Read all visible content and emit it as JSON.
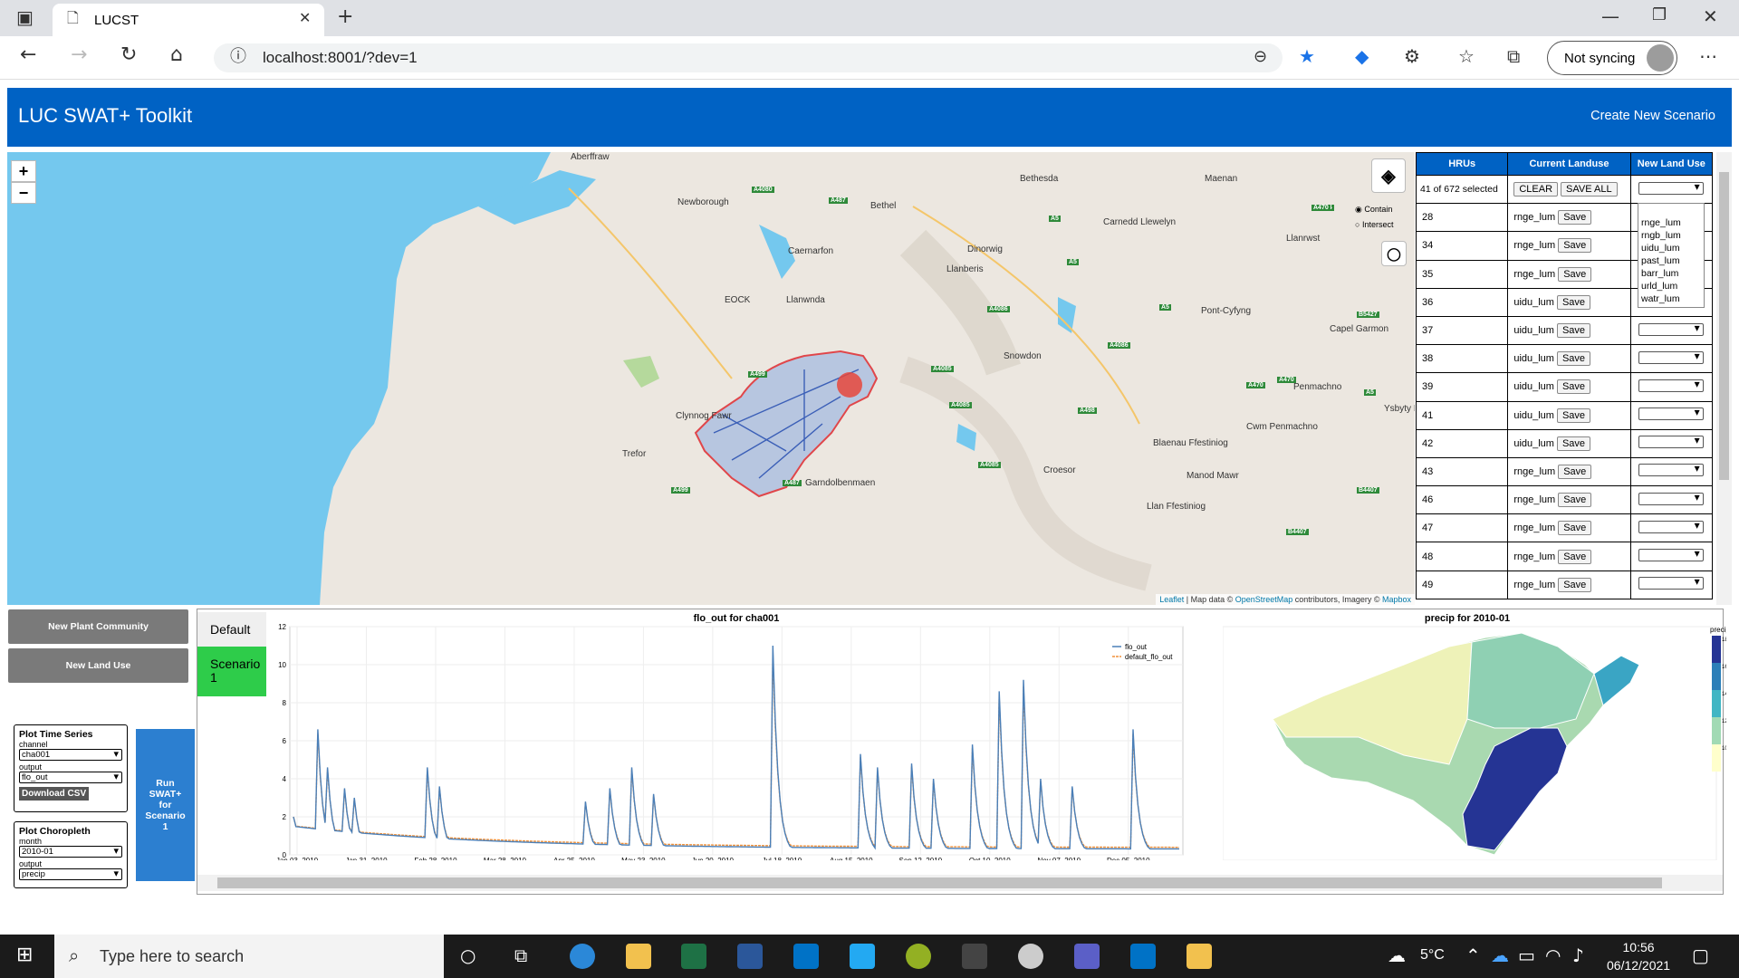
{
  "browser": {
    "tab_title": "LUCST",
    "url": "localhost:8001/?dev=1",
    "sync_label": "Not syncing"
  },
  "app": {
    "title": "LUC SWAT+ Toolkit",
    "create_scenario": "Create New Scenario"
  },
  "map": {
    "zoom_in": "+",
    "zoom_out": "−",
    "places": [
      "Aberffraw",
      "Newborough",
      "Caernarfon",
      "Bethel",
      "Bethesda",
      "Maenan",
      "Carnedd Llewelyn",
      "Llanrwst",
      "Dinorwig",
      "Llanberis",
      "Llanwnda",
      "Pont-Cyfyng",
      "Capel Garmon",
      "Snowdon",
      "Penmachno",
      "Clynnog Fawr",
      "Ysbyty I",
      "Cwm Penmachno",
      "Blaenau Ffestiniog",
      "Trefor",
      "Croesor",
      "Manod Mawr",
      "Garndolbenmaen",
      "Llan Ffestiniog",
      "EOCK"
    ],
    "roads": [
      "A4080",
      "A487",
      "A5",
      "A4244",
      "A5",
      "A470",
      "A4086",
      "A5",
      "B5427",
      "A499",
      "A4085",
      "A4086",
      "A470",
      "A470",
      "A5",
      "A498",
      "A4085",
      "A4085",
      "A487",
      "A499",
      "B4407",
      "B4407"
    ],
    "filter_options": [
      "Contain",
      "Intersect"
    ],
    "attribution": {
      "leaflet": "Leaflet",
      "text1": " | Map data © ",
      "osm": "OpenStreetMap",
      "text2": " contributors, Imagery © ",
      "mapbox": "Mapbox"
    }
  },
  "hru_table": {
    "headers": [
      "HRUs",
      "Current Landuse",
      "New Land Use"
    ],
    "selected_text": "41 of 672 selected",
    "clear_label": "CLEAR",
    "save_all_label": "SAVE ALL",
    "save_label": "Save",
    "rows": [
      [
        "28",
        "rnge_lum"
      ],
      [
        "34",
        "rnge_lum"
      ],
      [
        "35",
        "rnge_lum"
      ],
      [
        "36",
        "uidu_lum"
      ],
      [
        "37",
        "uidu_lum"
      ],
      [
        "38",
        "uidu_lum"
      ],
      [
        "39",
        "uidu_lum"
      ],
      [
        "41",
        "uidu_lum"
      ],
      [
        "42",
        "uidu_lum"
      ],
      [
        "43",
        "rnge_lum"
      ],
      [
        "46",
        "rnge_lum"
      ],
      [
        "47",
        "rnge_lum"
      ],
      [
        "48",
        "rnge_lum"
      ],
      [
        "49",
        "rnge_lum"
      ]
    ],
    "dropdown_options": [
      "rnge_lum",
      "rngb_lum",
      "uidu_lum",
      "past_lum",
      "barr_lum",
      "urld_lum",
      "watr_lum"
    ]
  },
  "sidebar": {
    "new_plant_community": "New Plant Community",
    "new_land_use": "New Land Use",
    "ts_form": {
      "title": "Plot Time Series",
      "channel_label": "channel",
      "channel_value": "cha001",
      "output_label": "output",
      "output_value": "flo_out",
      "download": "Download CSV"
    },
    "choro_form": {
      "title": "Plot Choropleth",
      "month_label": "month",
      "month_value": "2010-01",
      "output_label": "output",
      "output_value": "precip"
    },
    "run_button": "Run SWAT+ for Scenario 1"
  },
  "tabs": [
    "Default",
    "Scenario 1"
  ],
  "chart_data": [
    {
      "type": "line",
      "title": "flo_out for cha001",
      "x_ticks": [
        "Jan 03, 2010",
        "Jan 31, 2010",
        "Feb 28, 2010",
        "Mar 28, 2010",
        "Apr 25, 2010",
        "May 23, 2010",
        "Jun 20, 2010",
        "Jul 18, 2010",
        "Aug 15, 2010",
        "Sep 12, 2010",
        "Oct 10, 2010",
        "Nov 07, 2010",
        "Dec 05, 2010"
      ],
      "ylim": [
        0,
        12
      ],
      "y_ticks": [
        0,
        2,
        4,
        6,
        8,
        10,
        12
      ],
      "grid": true,
      "legend": "top-right",
      "series": [
        {
          "name": "flo_out",
          "color": "#4a7fb8",
          "values": [
            2,
            1.6,
            1.4,
            1.3,
            1.3,
            1.2,
            1.3,
            1.5,
            1.4,
            1.2,
            6.6,
            2,
            1.6,
            1.8,
            4.6,
            2.2,
            1.6,
            1.5,
            1.4,
            1.3,
            1.2,
            3.5,
            2,
            1.5,
            1.4,
            3,
            1.9,
            1.6,
            1.5,
            1.4,
            1.3,
            1.1,
            1.2,
            0.9,
            0.8,
            0.7,
            0.8,
            2,
            1.2,
            0.9,
            0.8,
            0.8,
            0.7,
            1,
            0.8,
            0.6,
            0.6,
            0.7,
            0.6,
            0.5,
            0.5,
            0.5,
            0.9,
            0.6,
            0.4,
            0.4,
            0.3,
            0.3,
            0.3,
            0.3,
            0.3,
            0.5,
            0.4,
            0.3,
            0.3,
            0.3,
            0.3,
            0.3,
            0.3,
            0.3,
            0.3,
            0.3,
            0.3,
            0.3,
            0.3,
            0.3,
            0.3,
            0.3,
            0.3,
            0.3,
            0.3,
            0.3,
            0.3,
            0.3,
            0.3,
            0.3,
            0.3,
            0.3,
            0.3,
            0.3,
            0.3,
            0.3,
            0.3,
            0.3,
            0.3,
            0.3,
            0.3,
            0.3,
            0.3,
            0.3,
            0.3,
            0.3,
            0.3,
            0.3,
            0.3,
            0.3,
            0.3,
            0.3,
            0.3,
            0.3,
            0.3,
            0.3,
            0.3,
            0.3,
            0.3,
            0.3,
            0.3,
            0.3,
            0.3,
            0.3,
            0.3,
            0.3,
            0.3,
            0.3,
            0.3,
            0.3,
            0.3,
            0.3,
            0.3,
            0.3,
            0.3,
            0.3,
            0.3,
            0.3,
            0.3,
            0.3,
            0.3,
            0.3,
            0.3,
            0.3,
            0.3,
            0.3,
            0.3,
            0.3,
            0.3,
            0.3,
            0.3,
            0.3,
            0.3,
            0.3,
            0.3,
            0.3,
            0.3,
            0.3,
            0.3,
            0.3,
            0.3,
            0.3,
            0.3,
            0.3,
            0.3,
            0.3,
            0.3,
            0.3,
            0.3,
            0.3,
            0.3,
            0.3,
            0.3,
            0.3,
            0.3,
            0.3,
            0.3,
            0.3,
            0.3,
            0.3,
            0.3,
            0.3,
            0.3,
            0.3,
            0.3,
            0.3,
            0.3,
            0.3,
            0.3,
            0.3,
            0.3,
            0.3,
            0.3,
            0.3,
            0.3,
            0.3,
            0.3,
            0.3,
            0.3,
            0.3,
            0.3,
            0.3,
            0.3,
            0.3,
            0.3,
            0.3,
            0.3,
            0.3,
            0.3,
            0.3,
            0.3,
            0.3,
            0.3,
            0.3,
            0.3,
            0.3,
            0.3,
            0.3,
            0.3,
            0.3,
            0.3,
            0.3,
            0.3,
            0.3,
            0.3,
            0.3,
            0.3,
            0.3,
            0.3,
            0.3,
            0.3,
            0.3,
            0.3,
            0.3,
            0.3,
            0.3,
            0.3,
            0.3,
            0.3,
            0.3,
            0.3,
            0.3,
            0.3,
            0.3,
            0.3,
            0.3,
            0.3,
            0.3,
            0.3,
            0.3,
            0.3,
            0.3,
            0.3,
            0.3,
            0.3,
            0.3,
            0.3,
            0.3,
            0.3,
            0.3,
            0.3,
            0.3,
            0.3,
            0.3,
            0.3,
            0.3,
            0.3,
            0.3,
            0.3,
            0.3,
            0.3,
            0.3,
            0.3,
            0.3,
            0.3,
            0.3,
            0.3,
            0.3,
            0.3,
            0.3,
            0.3,
            0.3,
            0.3,
            0.3,
            0.3,
            0.3,
            0.3,
            0.3,
            0.3,
            0.3,
            0.3,
            0.3,
            0.3,
            0.3,
            0.3,
            0.3,
            0.3,
            0.3,
            0.3,
            0.3,
            0.3,
            0.3,
            0.3,
            0.3,
            0.3,
            0.3,
            0.3,
            0.3,
            0.3,
            0.3,
            0.3,
            0.3,
            0.3,
            0.3,
            0.3,
            0.3,
            0.3,
            0.3,
            0.3,
            0.3,
            0.3,
            0.3,
            0.3,
            0.3,
            0.3,
            0.3,
            0.3,
            0.3,
            0.3,
            0.3,
            0.3,
            0.3,
            0.3,
            0.3,
            0.3,
            0.3,
            0.3,
            0.3,
            0.3,
            0.3,
            0.3,
            0.3,
            0.3,
            0.3,
            0.3,
            0.3,
            0.3,
            0.3,
            0.3,
            0.3,
            0.3,
            0.3,
            0.3,
            0.3,
            0.3,
            0.3,
            0.3,
            0.3,
            0.3,
            0.3,
            0.3,
            0.3,
            0.3,
            0.3,
            0.3,
            0.3,
            0.3,
            0.3,
            0.3,
            0.3
          ]
        },
        {
          "name": "default_flo_out",
          "color": "#f0913a",
          "values": []
        }
      ]
    },
    {
      "type": "heatmap",
      "title": "precip for 2010-01",
      "legend_label": "precip",
      "scale_ticks": [
        "18",
        "16",
        "14",
        "12",
        "10"
      ]
    }
  ],
  "taskbar": {
    "search_placeholder": "Type here to search",
    "temp": "5°C",
    "time": "10:56",
    "date": "06/12/2021"
  }
}
